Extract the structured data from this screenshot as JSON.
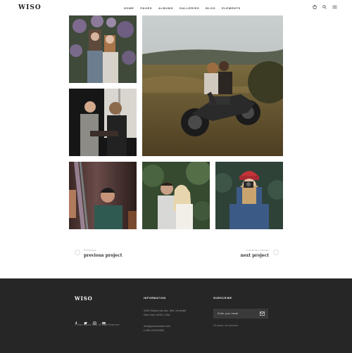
{
  "header": {
    "logo": "WISO",
    "nav": [
      "HOME",
      "PAGES",
      "ALBUMS",
      "GALLERIES",
      "BLOG",
      "ELEMENTS"
    ],
    "icons": [
      "cart-icon",
      "search-icon",
      "menu-icon"
    ]
  },
  "gallery": {
    "photos": [
      {
        "name": "couple-flowers-photo"
      },
      {
        "name": "couple-motorcycle-photo"
      },
      {
        "name": "couple-window-photo"
      },
      {
        "name": "man-beanie-photo"
      },
      {
        "name": "couple-embrace-photo"
      },
      {
        "name": "woman-camera-photo"
      }
    ]
  },
  "pager": {
    "prev_small": "Previous",
    "prev_big": "previous project",
    "next_small": "Continue ahead",
    "next_big": "next project"
  },
  "footer": {
    "logo": "WISO",
    "copyright": "© Wiso Studio 2018. All Right Reserved",
    "social_icons": [
      "facebook-icon",
      "twitter-icon",
      "instagram-icon",
      "flickr-icon"
    ],
    "info_title": "INFORMATION",
    "info_address1": "2005 Stokes Isle Apt. 896, Venaville",
    "info_address2": "New York 10010, USA",
    "info_email": "info@yourdomain.com",
    "info_phone": "(+68) 120034509",
    "subscribe_title": "SUBSCRIBE",
    "email_placeholder": "Enter your email",
    "no_spam": "No spam, we promise"
  },
  "colors": {
    "footer_bg": "#262626",
    "input_bg": "#3a3a3a"
  }
}
